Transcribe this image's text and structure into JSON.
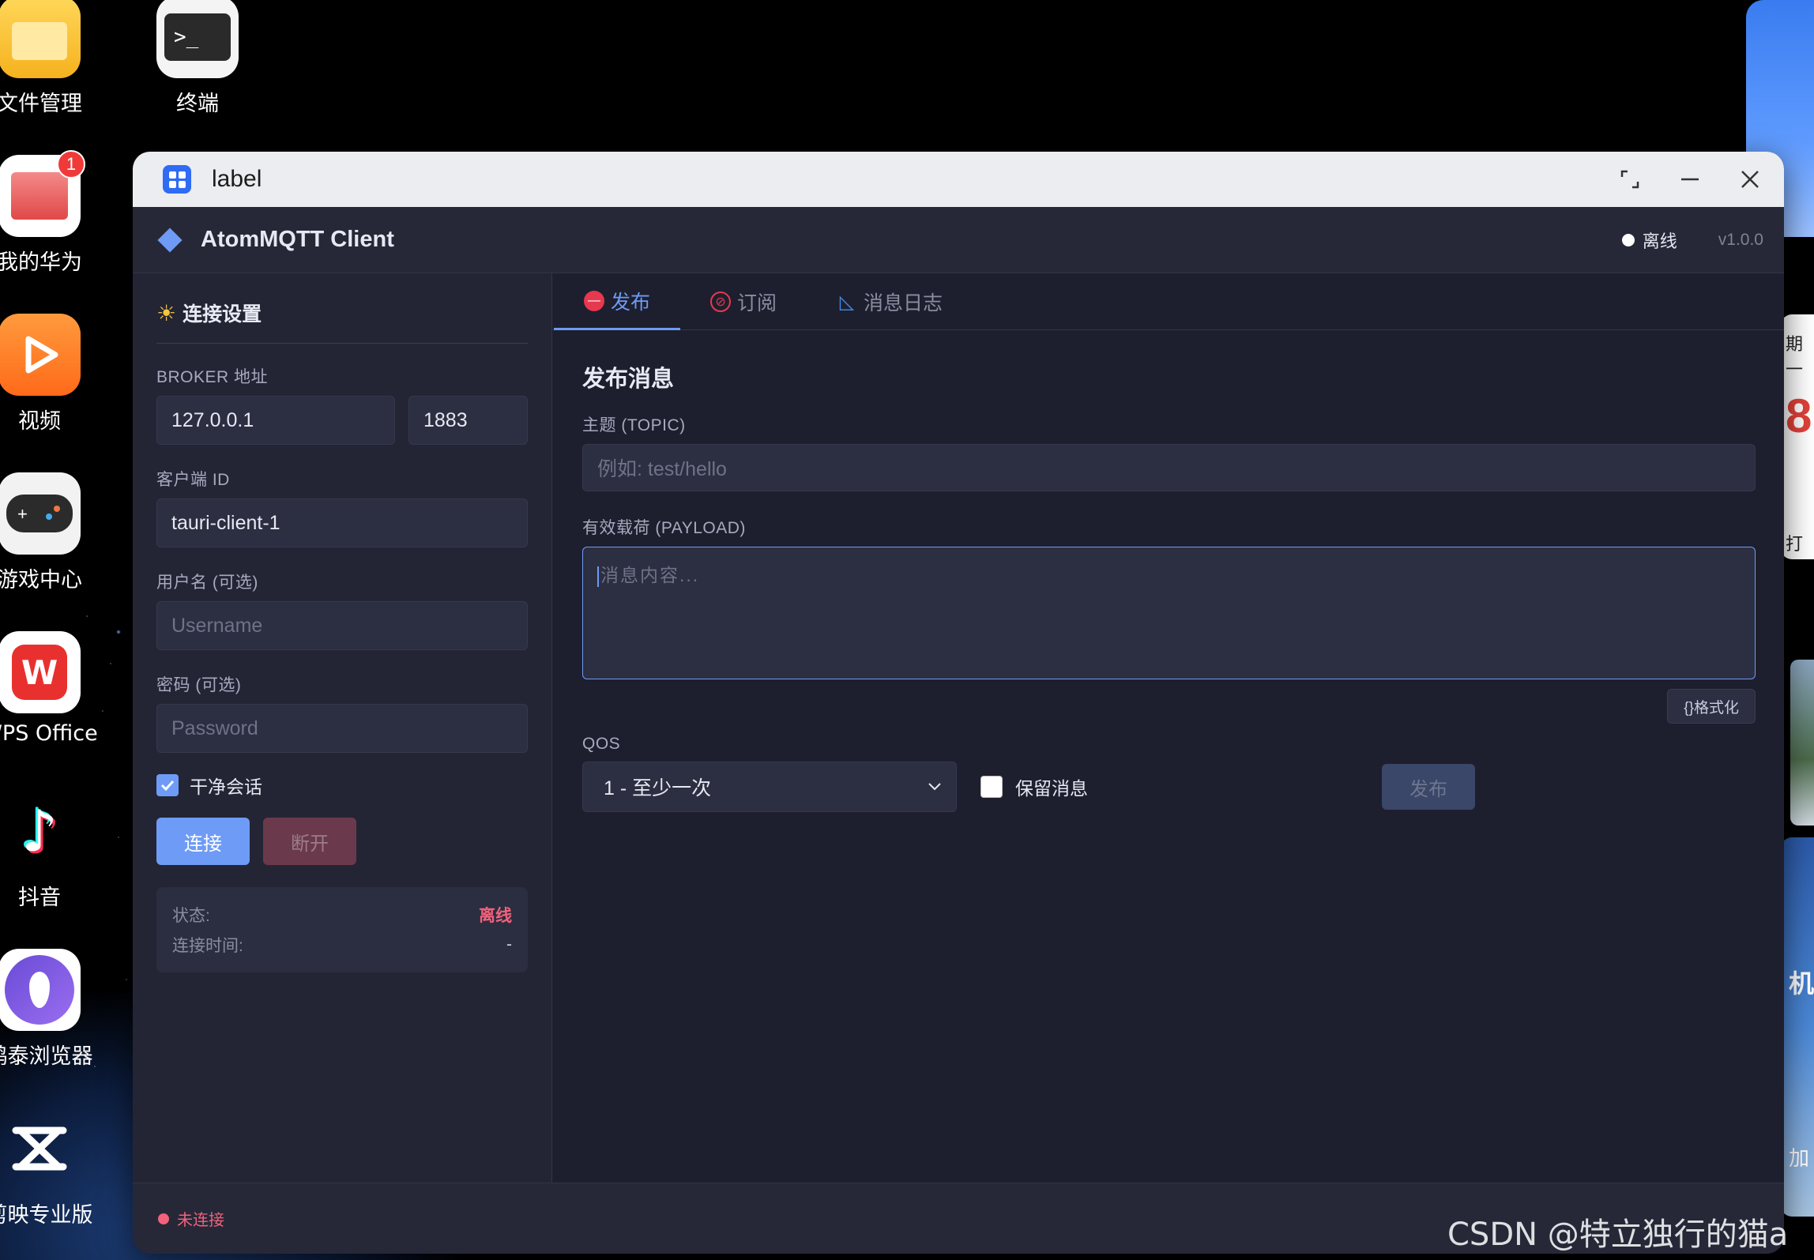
{
  "desktop": {
    "icons": [
      {
        "label": "文件管理",
        "icon": "folder-icon"
      },
      {
        "label": "终端",
        "icon": "terminal-icon"
      },
      {
        "label": "我的华为",
        "icon": "huawei-icon",
        "badge": "1"
      },
      {
        "label": "视频",
        "icon": "video-icon"
      },
      {
        "label": "游戏中心",
        "icon": "gamepad-icon"
      },
      {
        "label": "WPS Office",
        "icon": "wps-icon"
      },
      {
        "label": "抖音",
        "icon": "douyin-icon"
      },
      {
        "label": "鸿泰浏览器",
        "icon": "browser-icon"
      },
      {
        "label": "剪映专业版",
        "icon": "capcut-icon"
      }
    ],
    "right_edge_texts": {
      "cal_top": "期一",
      "cal_num": "8",
      "cal_open": "打开",
      "blue_a": "机",
      "blue_b": "加"
    },
    "watermark": "CSDN @特立独行的猫a"
  },
  "window": {
    "title": "label"
  },
  "app": {
    "brand": "AtomMQTT Client",
    "status": "离线",
    "version": "v1.0.0",
    "colors": {
      "accent": "#6e9bf5",
      "danger": "#f2627b",
      "bg": "#1e1f2e"
    }
  },
  "sidebar": {
    "title": "连接设置",
    "broker_label": "BROKER 地址",
    "broker_host": "127.0.0.1",
    "broker_port": "1883",
    "client_id_label": "客户端 ID",
    "client_id": "tauri-client-1",
    "username_label": "用户名 (可选)",
    "username_placeholder": "Username",
    "password_label": "密码 (可选)",
    "password_placeholder": "Password",
    "clean_session_label": "干净会话",
    "clean_session_checked": true,
    "connect_label": "连接",
    "disconnect_label": "断开",
    "status_label": "状态:",
    "status_value": "离线",
    "connect_time_label": "连接时间:",
    "connect_time_value": "-"
  },
  "tabs": [
    {
      "label": "发布",
      "icon": "publish-icon",
      "active": true
    },
    {
      "label": "订阅",
      "icon": "subscribe-icon",
      "active": false
    },
    {
      "label": "消息日志",
      "icon": "ruler-icon",
      "active": false
    }
  ],
  "publish": {
    "title": "发布消息",
    "topic_label": "主题 (TOPIC)",
    "topic_placeholder": "例如: test/hello",
    "payload_label": "有效载荷 (PAYLOAD)",
    "payload_placeholder": "消息内容...",
    "format_label": "{}格式化",
    "qos_label": "QOS",
    "qos_selected": "1 - 至少一次",
    "retain_label": "保留消息",
    "retain_checked": false,
    "publish_label": "发布"
  },
  "footer": {
    "status": "未连接"
  }
}
